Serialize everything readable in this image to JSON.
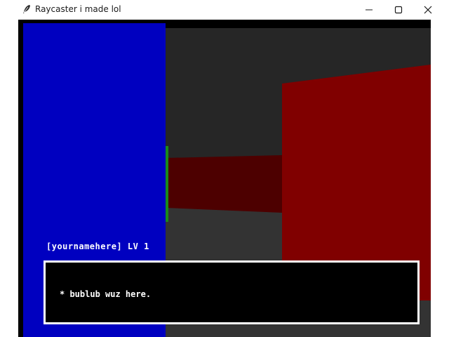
{
  "window": {
    "title": "Raycaster i made lol",
    "icon": "feather-icon",
    "controls": [
      "minimize-icon",
      "maximize-icon",
      "close-icon"
    ]
  },
  "hud": {
    "player_name": "[yournamehere]",
    "level_label": "LV",
    "level": "1"
  },
  "dialog": {
    "text": "* bublub wuz here."
  },
  "colors": {
    "ceiling": "#262626",
    "floor": "#333333",
    "blue_wall": "#0000c0",
    "red_wall_near": "#800000",
    "red_wall_far": "#4d0000",
    "green_wall": "#1a8a1a"
  }
}
